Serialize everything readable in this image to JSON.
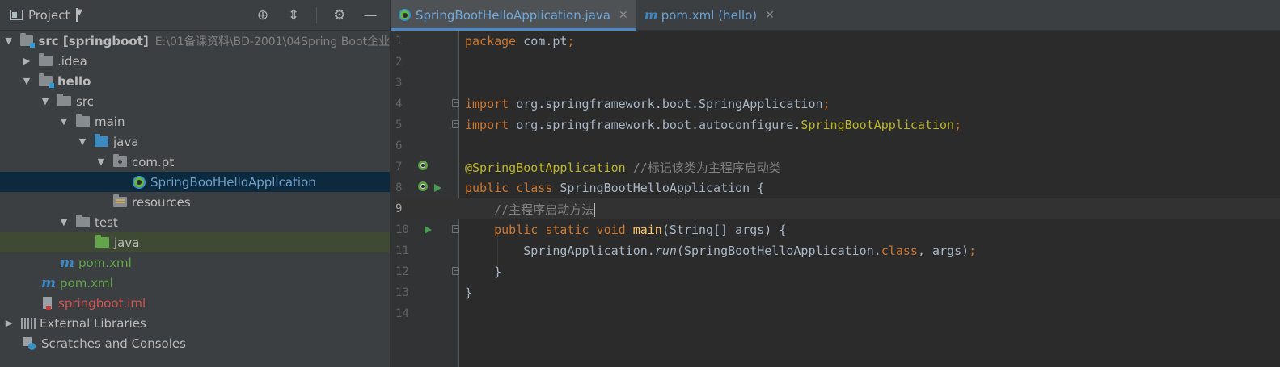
{
  "project_panel": {
    "title": "Project",
    "tools": [
      "locate-icon",
      "collapse-icon",
      "gear-icon",
      "minimize-icon"
    ],
    "tree": [
      {
        "label": "src [springboot]",
        "path": "E:\\01备课资料\\BD-2001\\04Spring Boot企业",
        "icon": "module-folder-icon",
        "expanded": true
      },
      {
        "label": ".idea",
        "icon": "folder-icon",
        "expanded": false
      },
      {
        "label": "hello",
        "icon": "module-folder-icon",
        "expanded": true
      },
      {
        "label": "src",
        "icon": "folder-icon",
        "expanded": true
      },
      {
        "label": "main",
        "icon": "folder-icon",
        "expanded": true
      },
      {
        "label": "java",
        "icon": "source-folder-icon",
        "expanded": true
      },
      {
        "label": "com.pt",
        "icon": "package-icon",
        "expanded": true
      },
      {
        "label": "SpringBootHelloApplication",
        "icon": "spring-boot-class-icon",
        "selected": true
      },
      {
        "label": "resources",
        "icon": "resources-folder-icon"
      },
      {
        "label": "test",
        "icon": "folder-icon",
        "expanded": true
      },
      {
        "label": "java",
        "icon": "test-source-folder-icon"
      },
      {
        "label": "pom.xml",
        "icon": "maven-icon"
      },
      {
        "label": "pom.xml",
        "icon": "maven-icon"
      },
      {
        "label": "springboot.iml",
        "icon": "iml-file-icon"
      },
      {
        "label": "External Libraries",
        "icon": "library-icon",
        "expanded": false
      },
      {
        "label": "Scratches and Consoles",
        "icon": "scratches-icon"
      }
    ]
  },
  "tabs": [
    {
      "label": "SpringBootHelloApplication.java",
      "active": true,
      "icon": "spring-boot-class-icon"
    },
    {
      "label": "pom.xml (hello)",
      "active": false,
      "icon": "maven-icon"
    }
  ],
  "editor": {
    "line_numbers": [
      "1",
      "2",
      "3",
      "4",
      "5",
      "6",
      "7",
      "8",
      "9",
      "10",
      "11",
      "12",
      "13",
      "14"
    ],
    "current_line": 9,
    "code": {
      "l1_kw": "package",
      "l1_rest": " com.pt",
      "l1_semi": ";",
      "l4_kw": "import",
      "l4_rest": " org.springframework.boot.SpringApplication",
      "l4_semi": ";",
      "l5_kw": "import",
      "l5_rest": " org.springframework.boot.autoconfigure.",
      "l5_ann": "SpringBootApplication",
      "l5_semi": ";",
      "l7_ann": "@SpringBootApplication",
      "l7_cmt": " //标记该类为主程序启动类",
      "l8_kw": "public class",
      "l8_rest": " SpringBootHelloApplication {",
      "l9_cmt": "    //主程序启动方法",
      "l10_kw": "    public static void",
      "l10_fn": " main",
      "l10_rest": "(String[] args) {",
      "l11_a": "        SpringApplication.",
      "l11_it": "run",
      "l11_b": "(SpringBootHelloApplication.",
      "l11_kw": "class",
      "l11_c": ", args)",
      "l11_semi": ";",
      "l12": "    }",
      "l13": "}"
    }
  }
}
